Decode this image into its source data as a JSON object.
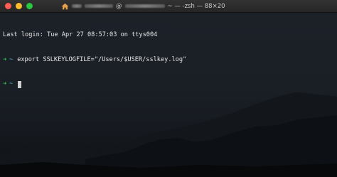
{
  "window": {
    "title": "~ — -zsh — 88×20",
    "title_at": "@"
  },
  "terminal": {
    "last_login": "Last login: Tue Apr 27 08:57:03 on ttys004",
    "prompt_arrow": "➜",
    "prompt_dir": "~",
    "command": "export SSLKEYLOGFILE=\"/Users/$USER/sslkey.log\""
  },
  "colors": {
    "prompt_green": "#2fcf52",
    "dir_cyan": "#3ec6c9",
    "close": "#fe5f57",
    "minimize": "#febc2e",
    "maximize": "#28c840"
  }
}
